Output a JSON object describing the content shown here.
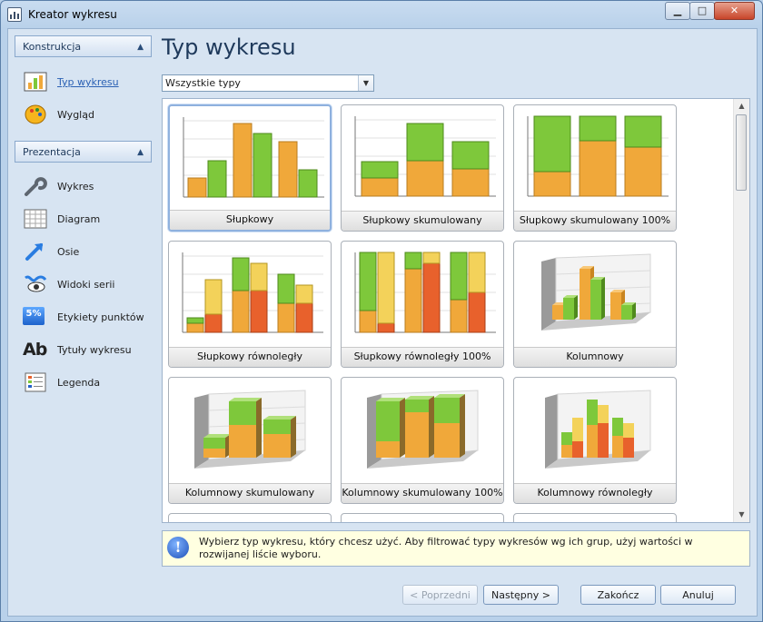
{
  "window": {
    "title": "Kreator wykresu",
    "min_label": "▁",
    "max_label": "□",
    "close_label": "✕"
  },
  "sidebar": {
    "groups": [
      {
        "label": "Konstrukcja"
      },
      {
        "label": "Prezentacja"
      }
    ],
    "construction_items": [
      {
        "label": "Typ wykresu",
        "icon": "bar-chart-icon",
        "active": true
      },
      {
        "label": "Wygląd",
        "icon": "palette-icon",
        "active": false
      }
    ],
    "presentation_items": [
      {
        "label": "Wykres",
        "icon": "wrench-icon"
      },
      {
        "label": "Diagram",
        "icon": "grid-icon"
      },
      {
        "label": "Osie",
        "icon": "axis-arrow-icon"
      },
      {
        "label": "Widoki serii",
        "icon": "series-view-icon"
      },
      {
        "label": "Etykiety punktów",
        "icon": "point-label-icon",
        "icon_text": "5%"
      },
      {
        "label": "Tytuły wykresu",
        "icon": "title-text-icon",
        "icon_text": "Ab"
      },
      {
        "label": "Legenda",
        "icon": "legend-icon"
      }
    ]
  },
  "main": {
    "title": "Typ wykresu",
    "filter": {
      "value": "Wszystkie typy"
    },
    "chart_types": [
      {
        "label": "Słupkowy",
        "selected": true
      },
      {
        "label": "Słupkowy skumulowany"
      },
      {
        "label": "Słupkowy skumulowany 100%"
      },
      {
        "label": "Słupkowy równoległy"
      },
      {
        "label": "Słupkowy równoległy 100%"
      },
      {
        "label": "Kolumnowy"
      },
      {
        "label": "Kolumnowy skumulowany"
      },
      {
        "label": "Kolumnowy skumulowany 100%"
      },
      {
        "label": "Kolumnowy równoległy"
      }
    ],
    "hint": "Wybierz typ wykresu, który chcesz użyć. Aby filtrować typy wykresów wg ich grup, użyj wartości w rozwijanej liście wyboru."
  },
  "footer": {
    "prev_label": "< Poprzedni",
    "next_label": "Następny >",
    "finish_label": "Zakończ",
    "cancel_label": "Anuluj"
  },
  "colors": {
    "orange": "#f0a83a",
    "green": "#7ec83b",
    "yellow": "#f3d25a",
    "red": "#e8612c",
    "accent": "#1e395b"
  }
}
